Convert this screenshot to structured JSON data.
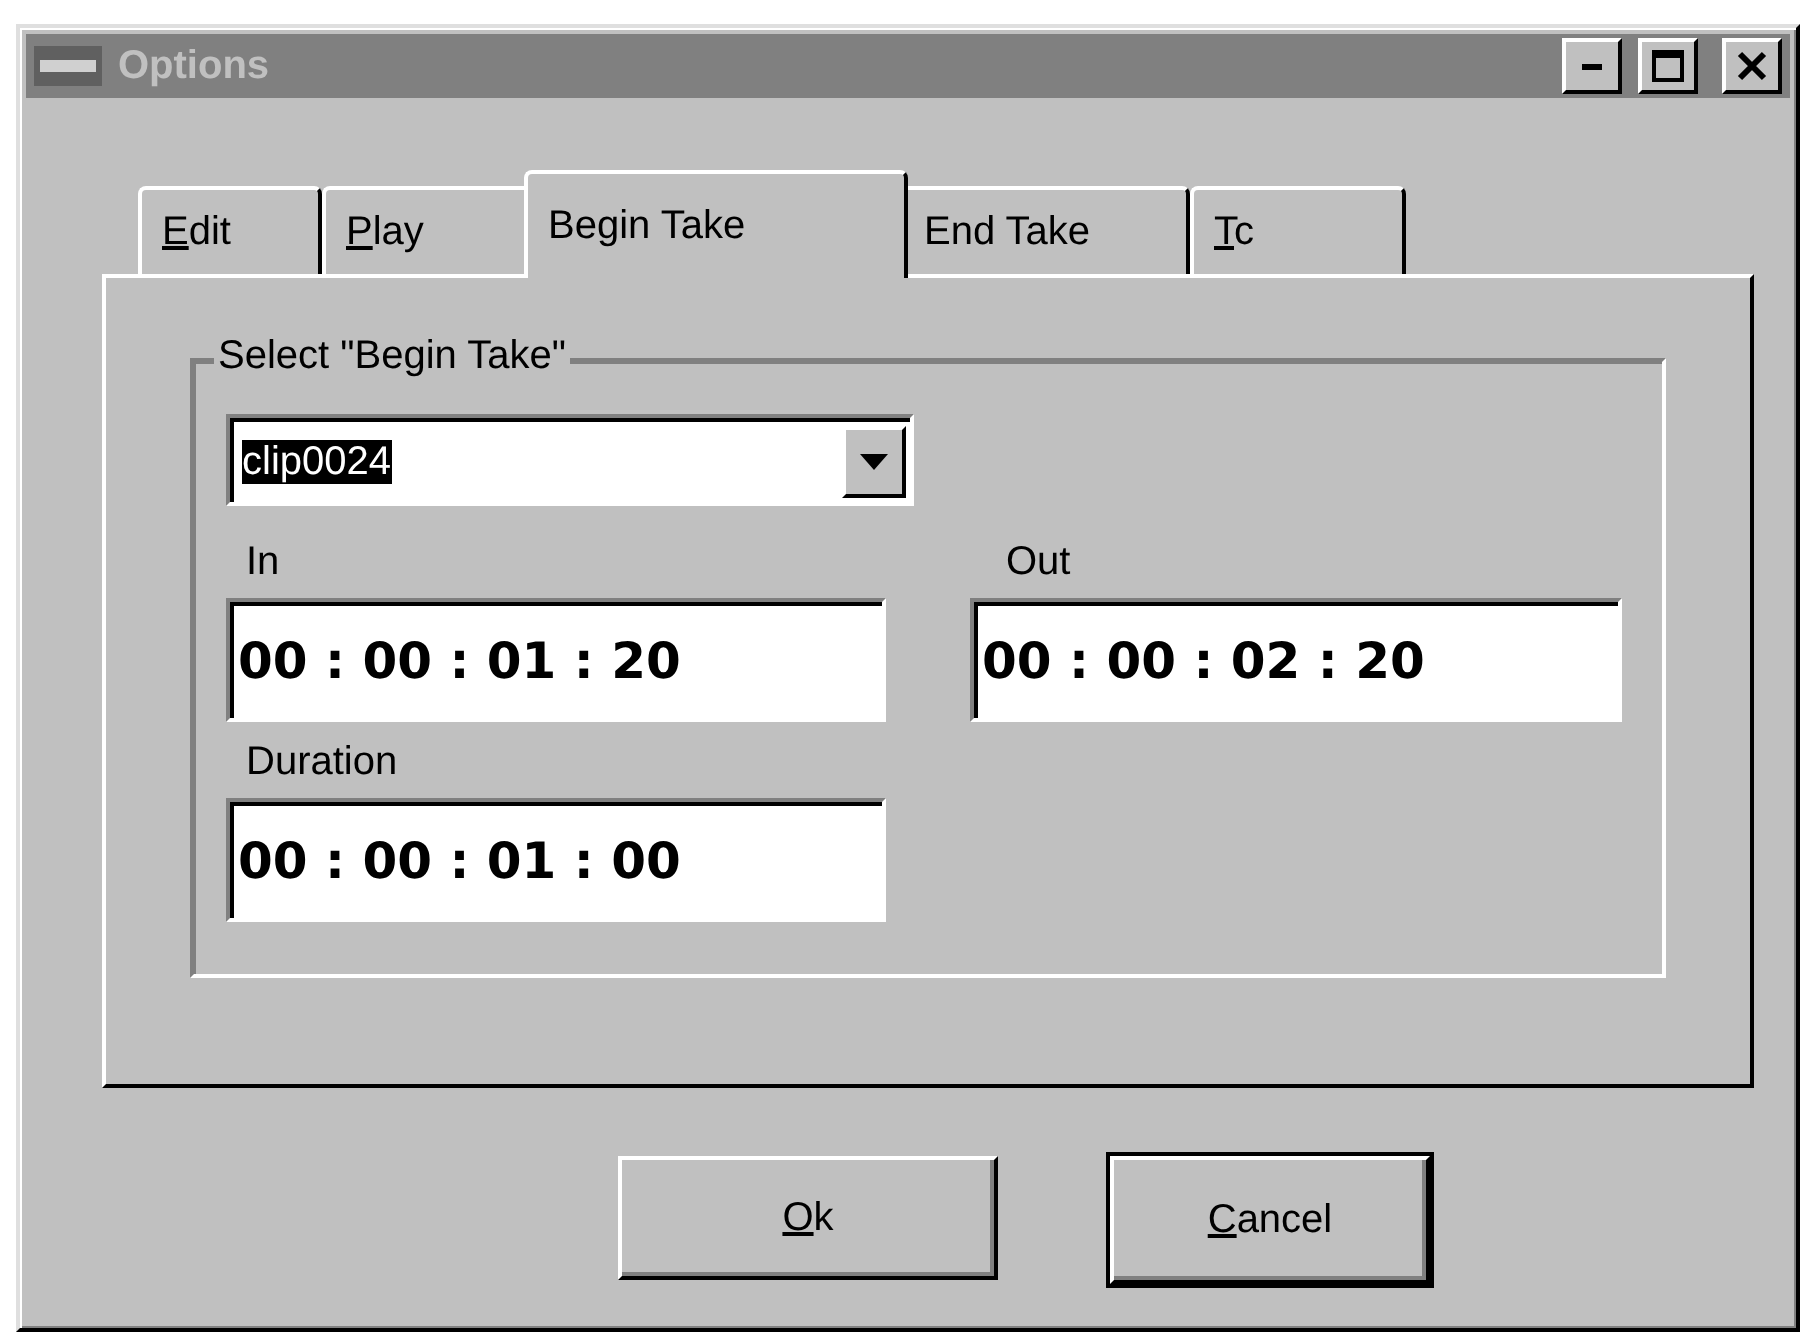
{
  "window": {
    "title": "Options",
    "active": false
  },
  "tabs": [
    {
      "label": "Edit",
      "underline_first": true,
      "selected": false
    },
    {
      "label": "Play",
      "underline_first": true,
      "selected": false
    },
    {
      "label": "Begin Take",
      "underline_first": false,
      "selected": true
    },
    {
      "label": "End Take",
      "underline_first": false,
      "selected": false
    },
    {
      "label": "Tc",
      "underline_first": true,
      "selected": false
    }
  ],
  "group": {
    "title": "Select \"Begin Take\"",
    "combo_value": "clip0024",
    "fields": [
      {
        "label": "In",
        "value": "00 : 00 : 01 : 20"
      },
      {
        "label": "Out",
        "value": "00 : 00 : 02 : 20"
      },
      {
        "label": "Duration",
        "value": "00 : 00 : 01 : 00"
      }
    ]
  },
  "buttons": [
    {
      "label": "Ok",
      "underline_first": true,
      "default": false
    },
    {
      "label": "Cancel",
      "underline_first": true,
      "default": true
    }
  ]
}
